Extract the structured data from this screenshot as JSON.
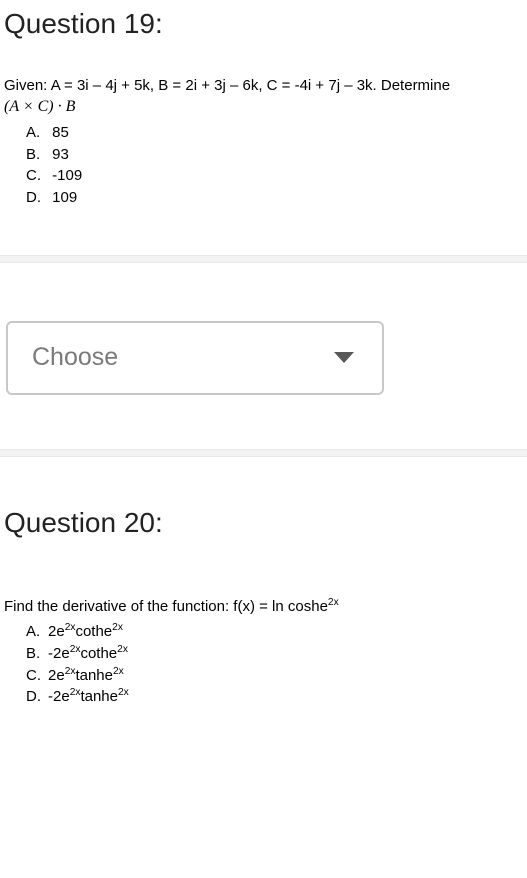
{
  "q19": {
    "title": "Question 19:",
    "prompt_line1": "Given:  A = 3i – 4j + 5k, B = 2i + 3j – 6k, C = -4i + 7j – 3k.  Determine",
    "prompt_line2_html": "(A × C) · B",
    "options": {
      "a": {
        "letter": "A.",
        "text": "85"
      },
      "b": {
        "letter": "B.",
        "text": "93"
      },
      "c": {
        "letter": "C.",
        "text": "-109"
      },
      "d": {
        "letter": "D.",
        "text": "109"
      }
    }
  },
  "dropdown": {
    "placeholder": "Choose"
  },
  "q20": {
    "title": "Question 20:",
    "prompt_prefix": "Find the derivative of the function: f(x) = ln coshe",
    "prompt_sup": "2x",
    "options": {
      "a": {
        "letter": "A.",
        "pre": "2e",
        "sup1": "2x",
        "mid": "cothe",
        "sup2": "2x"
      },
      "b": {
        "letter": "B.",
        "pre": "-2e",
        "sup1": "2x",
        "mid": "cothe",
        "sup2": "2x"
      },
      "c": {
        "letter": "C.",
        "pre": "2e",
        "sup1": "2x",
        "mid": "tanhe",
        "sup2": "2x"
      },
      "d": {
        "letter": "D.",
        "pre": "-2e",
        "sup1": "2x",
        "mid": "tanhe",
        "sup2": "2x"
      }
    }
  }
}
